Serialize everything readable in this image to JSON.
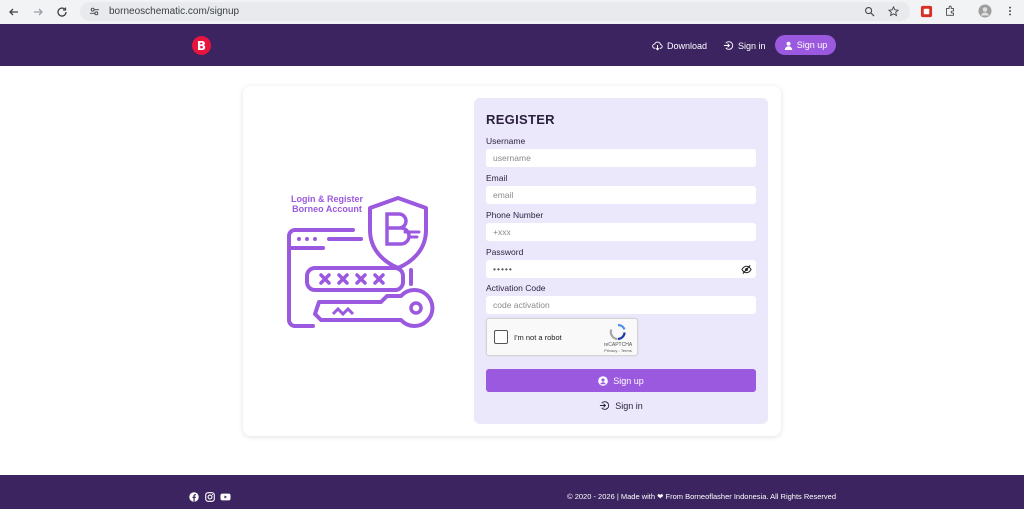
{
  "browser": {
    "url": "borneoschematic.com/signup"
  },
  "header": {
    "logo_letter": "B",
    "download_label": "Download",
    "signin_label": "Sign in",
    "signup_label": "Sign up"
  },
  "illustration": {
    "title_line1": "Login & Register",
    "title_line2": "Borneo Account"
  },
  "form": {
    "title": "REGISTER",
    "fields": [
      {
        "label": "Username",
        "placeholder": "username",
        "value": ""
      },
      {
        "label": "Email",
        "placeholder": "email",
        "value": ""
      },
      {
        "label": "Phone Number",
        "placeholder": "+xxx",
        "value": ""
      },
      {
        "label": "Password",
        "placeholder": "",
        "value": "•••••"
      },
      {
        "label": "Activation Code",
        "placeholder": "code activation",
        "value": ""
      }
    ],
    "captcha": {
      "label": "I'm not a robot",
      "brand": "reCAPTCHA",
      "terms": "Privacy - Terms"
    },
    "submit_label": "Sign up",
    "signin_link_label": "Sign in"
  },
  "footer": {
    "copyright": "© 2020 - 2026 | Made with ❤ From Borneoflasher Indonesia. All Rights Reserved"
  },
  "colors": {
    "header_bg": "#3b2460",
    "accent": "#9b59e0",
    "logo": "#e7143d",
    "panel_bg": "#ece8fb"
  },
  "icons": {
    "social": [
      "facebook-icon",
      "instagram-icon",
      "youtube-icon"
    ]
  }
}
